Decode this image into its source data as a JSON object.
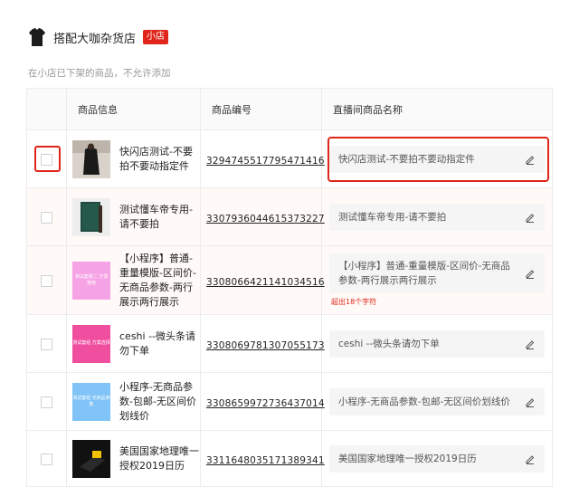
{
  "store": {
    "name": "搭配大咖杂货店",
    "tag": "小店",
    "notice": "在小店已下架的商品，不允许添加"
  },
  "columns": {
    "info": "商品信息",
    "id": "商品编号",
    "live_name": "直播间商品名称"
  },
  "rows": [
    {
      "name": "快闪店测试-不要拍不要动指定件",
      "id": "3294745517795471416",
      "live_name": "快闪店测试-不要拍不要动指定件",
      "thumb": "photo"
    },
    {
      "name": "测试懂车帝专用-请不要拍",
      "id": "3307936044615373227",
      "live_name": "测试懂车帝专用-请不要拍",
      "thumb": "photo"
    },
    {
      "name": "【小程序】普通-重量模版-区间价-无商品参数-两行展示两行展示",
      "id": "3308066421141034516",
      "live_name": "【小程序】普通-重量模版-区间价-无商品参数-两行展示两行展示",
      "warning": "超出18个字符",
      "thumb": "pink-card",
      "thumb_text": "测试套组二 方便 使用"
    },
    {
      "name": "ceshi --微头条请勿下单",
      "id": "3308069781307055173",
      "live_name": "ceshi --微头条请勿下单",
      "thumb": "pink-card",
      "thumb_text": "测试套组 方案选择"
    },
    {
      "name": "小程序-无商品参数-包邮-无区间价划线价",
      "id": "3308659972736437014",
      "live_name": "小程序-无商品参数-包邮-无区间价划线价",
      "thumb": "blue-card",
      "thumb_text": "测试套组 无商品参数"
    },
    {
      "name": "美国国家地理唯一授权2019日历",
      "id": "3311648035171389341",
      "live_name": "美国国家地理唯一授权2019日历",
      "thumb": "photo"
    }
  ],
  "colors": {
    "accent": "#e0251b",
    "pink_card": "#f6a3e6",
    "pink_card2": "#f04fa0",
    "blue_card": "#7fc3f7"
  }
}
